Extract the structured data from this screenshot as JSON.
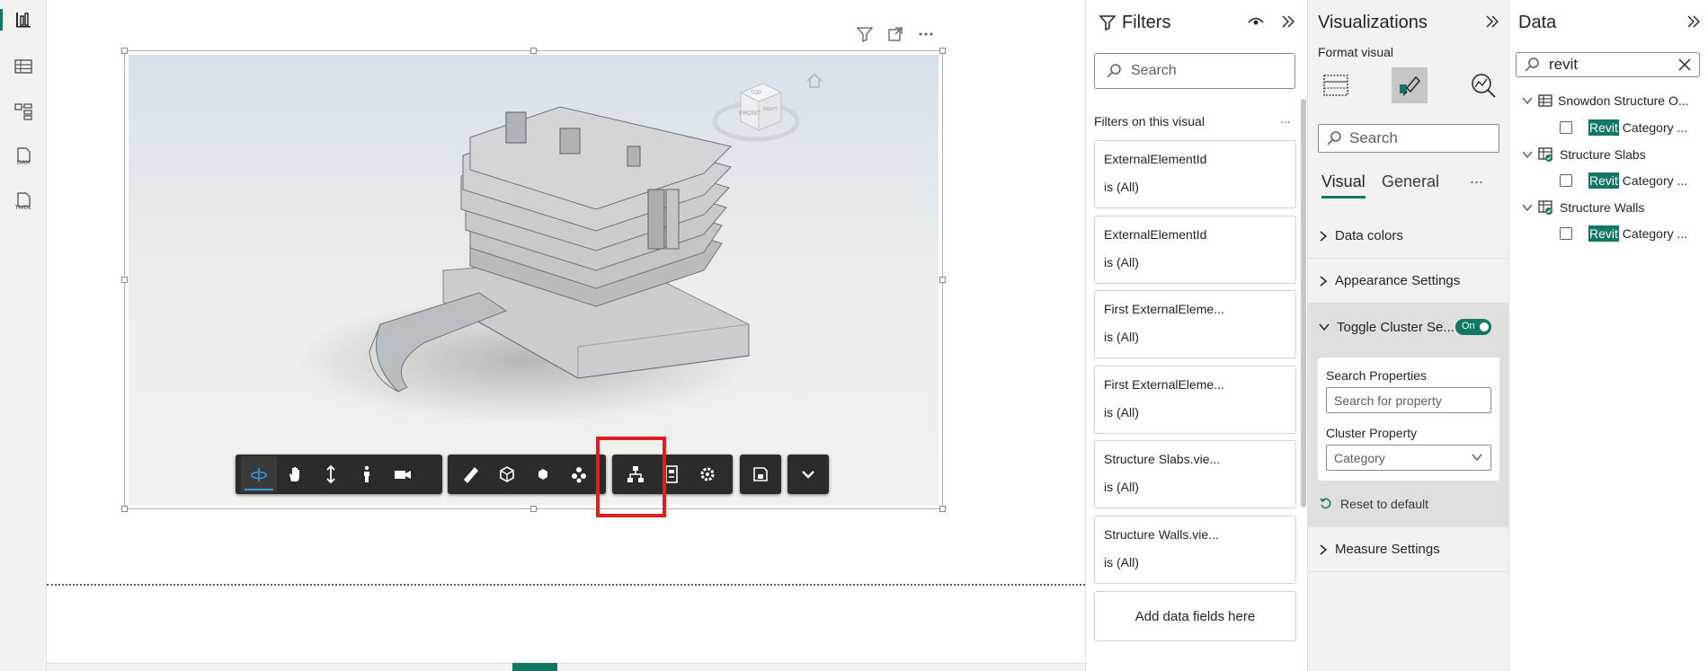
{
  "rail": {
    "dax_label": "DAX",
    "tmdl_label": "TMDL"
  },
  "filters": {
    "title": "Filters",
    "search_placeholder": "Search",
    "section": "Filters on this visual",
    "more": "...",
    "cards": [
      {
        "name": "ExternalElementId",
        "value": "is (All)"
      },
      {
        "name": "ExternalElementId",
        "value": "is (All)"
      },
      {
        "name": "First ExternalEleme...",
        "value": "is (All)"
      },
      {
        "name": "First ExternalEleme...",
        "value": "is (All)"
      },
      {
        "name": "Structure Slabs.vie...",
        "value": "is (All)"
      },
      {
        "name": "Structure Walls.vie...",
        "value": "is (All)"
      }
    ],
    "add_fields": "Add data fields here"
  },
  "viz": {
    "title": "Visualizations",
    "subtitle": "Format visual",
    "search_placeholder": "Search",
    "tab_visual": "Visual",
    "tab_general": "General",
    "tab_more": "...",
    "sections": {
      "data_colors": "Data colors",
      "appearance": "Appearance Settings",
      "cluster": "Toggle Cluster Se...",
      "measure": "Measure Settings"
    },
    "toggle_label": "On",
    "search_props_label": "Search Properties",
    "search_props_placeholder": "Search for property",
    "cluster_prop_label": "Cluster Property",
    "cluster_prop_value": "Category",
    "reset": "Reset to default"
  },
  "data": {
    "title": "Data",
    "search_value": "revit",
    "tables": [
      {
        "name": "Snowdon Structure O...",
        "field_hl": "Revit",
        "field_rest": " Category ..."
      },
      {
        "name": "Structure Slabs",
        "field_hl": "Revit",
        "field_rest": " Category ..."
      },
      {
        "name": "Structure Walls",
        "field_hl": "Revit",
        "field_rest": " Category ..."
      }
    ]
  },
  "viewcube": {
    "top": "TOP",
    "front": "FRONT",
    "right": "RIGHT"
  },
  "colors": {
    "accent": "#117865",
    "highlight_box": "#e02020",
    "toolbar_bg": "#2b2b2b",
    "toolbar_selected": "#2b9ae6"
  }
}
